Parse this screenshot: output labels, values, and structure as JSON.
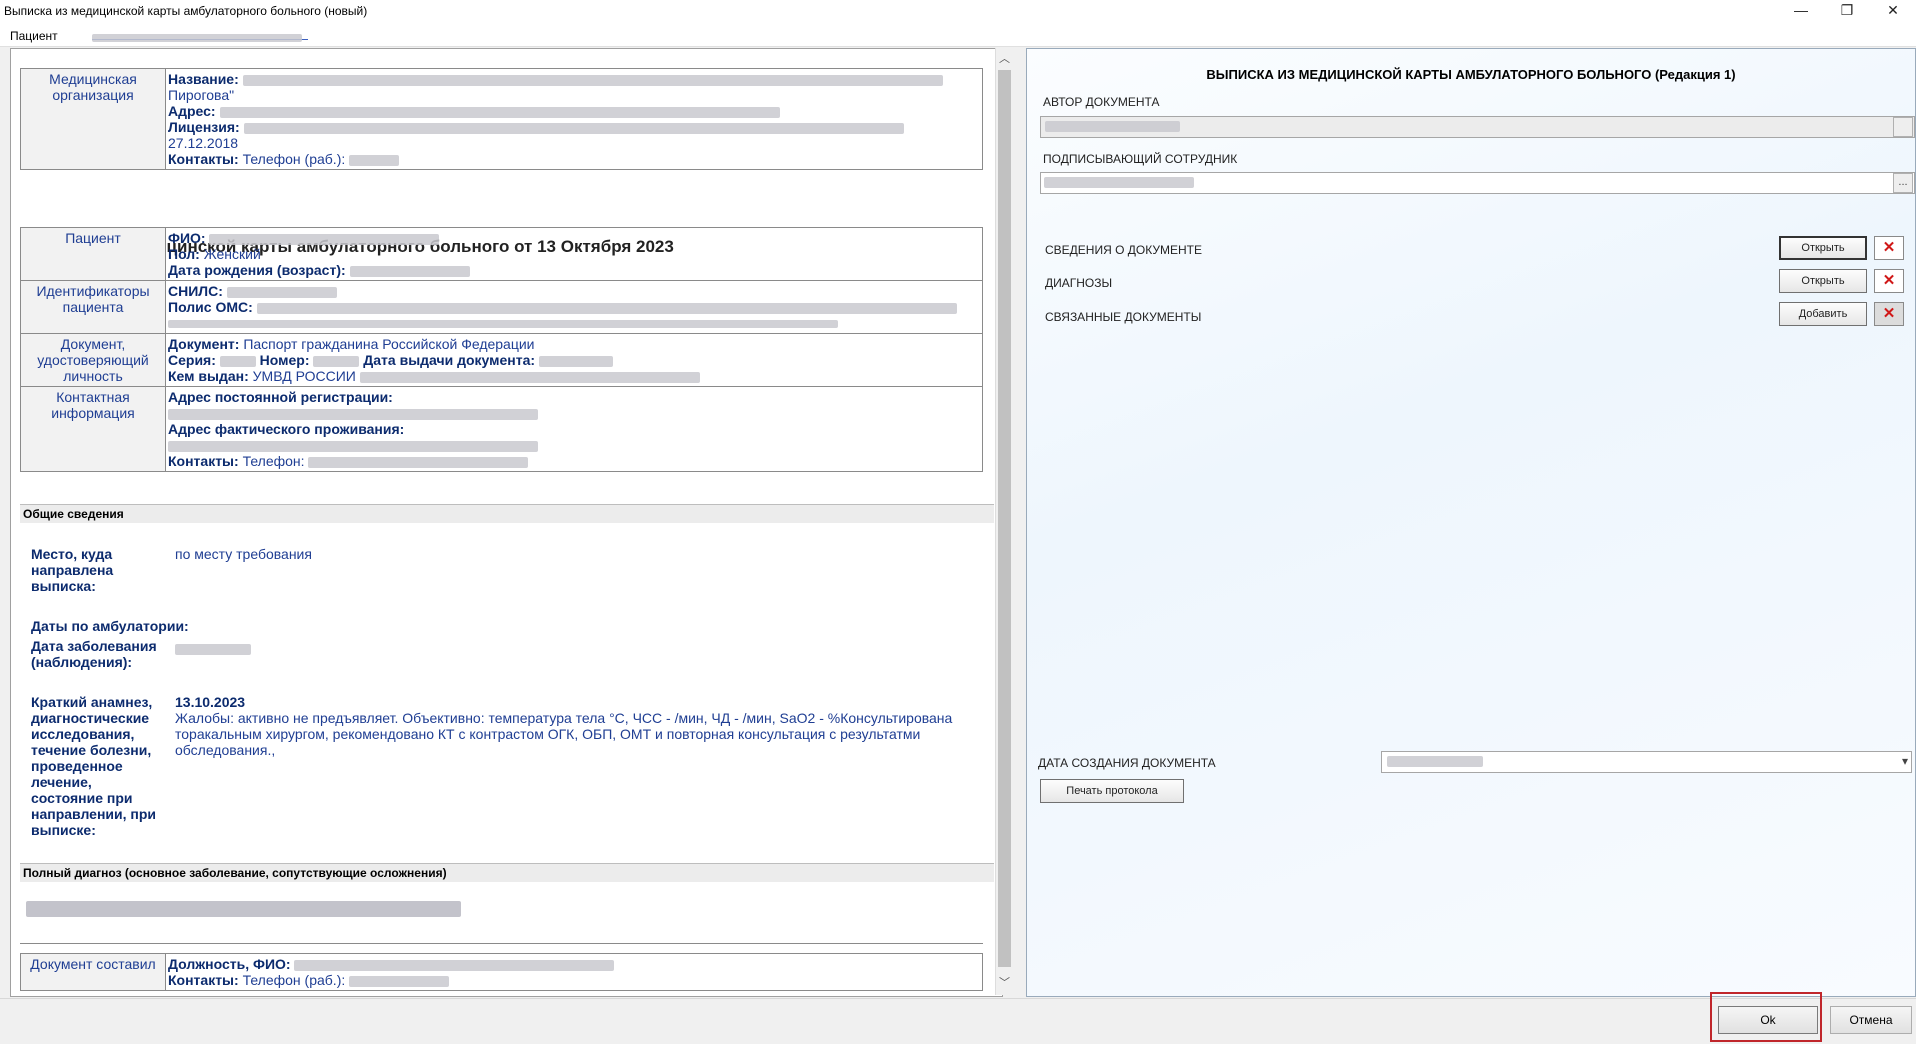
{
  "window": {
    "title": "Выписка из медицинской карты амбулаторного больного (новый)",
    "minimize_icon": "—",
    "restore_icon": "❐",
    "close_icon": "✕"
  },
  "patient_strip": {
    "label": "Пациент"
  },
  "document": {
    "org": {
      "header": "Медицинская организация",
      "name_label": "Название:",
      "name_tail": "Пирогова\"",
      "address_label": "Адрес:",
      "license_label": "Лицензия:",
      "license_date": "27.12.2018",
      "contacts_label": "Контакты:",
      "contacts_value": "Телефон (раб.):"
    },
    "title": "Выписка из медицинской карты амбулаторного больного от 13 Октября 2023",
    "patient": {
      "header": "Пациент",
      "fio_label": "ФИО:",
      "sex_label": "Пол:",
      "sex_value": "Женский",
      "dob_label": "Дата рождения (возраст):"
    },
    "ids": {
      "header": "Идентификаторы пациента",
      "snils_label": "СНИЛС:",
      "oms_label": "Полис ОМС:"
    },
    "id_doc": {
      "header": "Документ, удостоверяющий личность",
      "doc_label": "Документ:",
      "doc_value": "Паспорт гражданина Российской Федерации",
      "series_label": "Серия:",
      "number_label": "Номер:",
      "issue_date_label": "Дата выдачи документа:",
      "issued_by_label": "Кем выдан:",
      "issued_by_value": "УМВД РОССИИ"
    },
    "contact": {
      "header": "Контактная информация",
      "reg_label": "Адрес постоянной регистрации:",
      "live_label": "Адрес фактического проживания:",
      "contacts_label": "Контакты:",
      "contacts_value": "Телефон:"
    },
    "general_section": "Общие сведения",
    "place_label": "Место, куда направлена выписка:",
    "place_value": "по месту требования",
    "dates_label": "Даты по амбулатории:",
    "onset_label": "Дата заболевания (наблюдения):",
    "anamnesis_label": "Краткий анамнез, диагностические исследования, течение болезни, проведенное лечение, состояние при направлении, при выписке:",
    "anamnesis_date": "13.10.2023",
    "anamnesis_text": "Жалобы: активно не предъявляет. Объективно: температура тела °С, ЧСС - /мин, ЧД - /мин, SaO2 - %Консультирована торакальным хирургом, рекомендовано КТ с контрастом ОГК, ОБП, ОМТ и повторная консультация с результатми обследования.,",
    "diagnosis_section": "Полный диагноз (основное заболевание, сопутствующие осложнения)",
    "author": {
      "header": "Документ составил",
      "pos_label": "Должность, ФИО:",
      "contacts_label": "Контакты:",
      "contacts_value": "Телефон (раб.):"
    }
  },
  "editor": {
    "title": "ВЫПИСКА ИЗ МЕДИЦИНСКОЙ КАРТЫ АМБУЛАТОРНОГО БОЛЬНОГО (Редакция 1)",
    "author_label": "АВТОР ДОКУМЕНТА",
    "signer_label": "ПОДПИСЫВАЮЩИЙ СОТРУДНИК",
    "ellipsis": "...",
    "rows": [
      {
        "label": "СВЕДЕНИЯ О ДОКУМЕНТЕ",
        "button": "Открыть"
      },
      {
        "label": "ДИАГНОЗЫ",
        "button": "Открыть"
      },
      {
        "label": "СВЯЗАННЫЕ ДОКУМЕНТЫ",
        "button": "Добавить"
      }
    ],
    "delete_icon": "✕",
    "date_label": "ДАТА СОЗДАНИЯ ДОКУМЕНТА",
    "date_dropdown_icon": "▾",
    "print_button": "Печать протокола"
  },
  "footer": {
    "ok": "Ok",
    "cancel": "Отмена"
  },
  "scroll": {
    "up": "︿",
    "down": "﹀"
  }
}
